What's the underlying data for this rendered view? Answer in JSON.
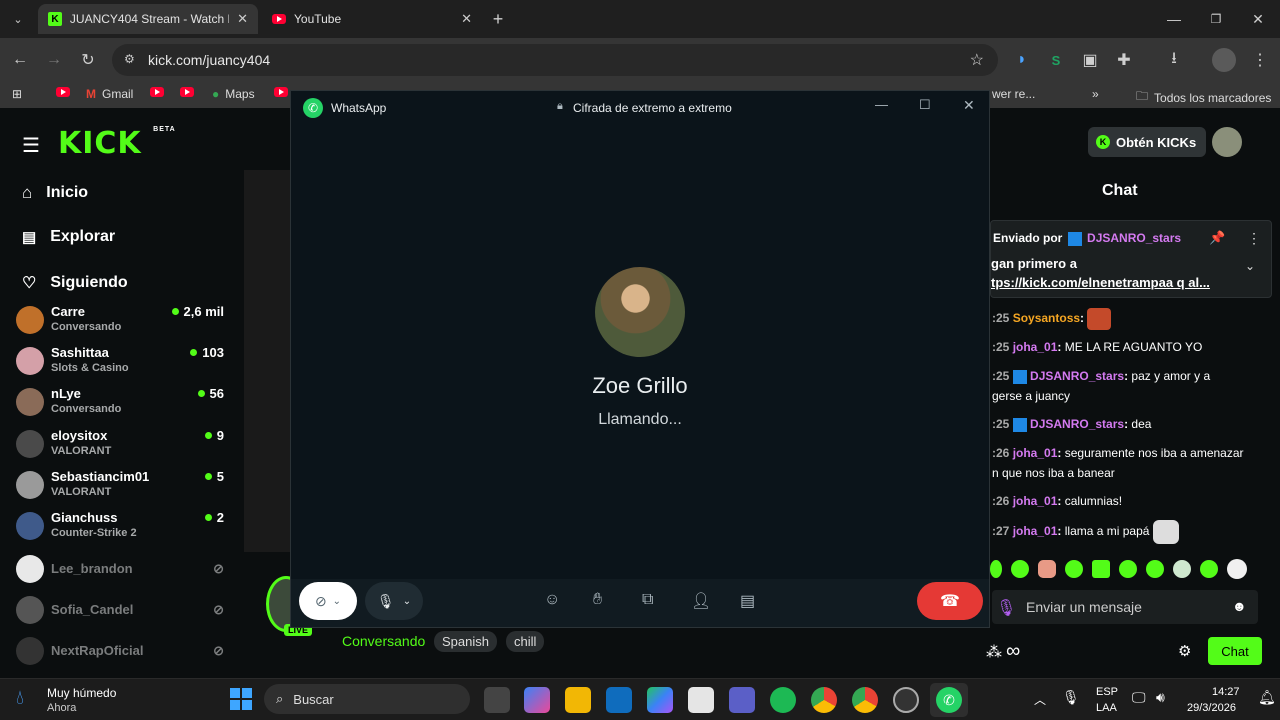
{
  "browser": {
    "tabs": [
      {
        "title": "JUANCY404 Stream - Watch Liv"
      },
      {
        "title": "YouTube"
      }
    ],
    "url": "kick.com/juancy404",
    "bookmarks": [
      "Gmail",
      "Maps",
      "wer re...",
      "Todos los marcadores"
    ]
  },
  "kick": {
    "logo": "KICK",
    "logo_badge": "BETA",
    "nav": [
      "Inicio",
      "Explorar",
      "Siguiendo"
    ],
    "channels": [
      {
        "name": "Carre",
        "sub": "Conversando",
        "viewers": "2,6 mil",
        "live": true
      },
      {
        "name": "Sashittaa",
        "sub": "Slots & Casino",
        "viewers": "103",
        "live": true
      },
      {
        "name": "nLye",
        "sub": "Conversando",
        "viewers": "56",
        "live": true
      },
      {
        "name": "eloysitox",
        "sub": "VALORANT",
        "viewers": "9",
        "live": true
      },
      {
        "name": "Sebastiancim01",
        "sub": "VALORANT",
        "viewers": "5",
        "live": true
      },
      {
        "name": "Gianchuss",
        "sub": "Counter-Strike 2",
        "viewers": "2",
        "live": true
      },
      {
        "name": "Lee_brandon",
        "sub": "",
        "viewers": "",
        "live": false
      },
      {
        "name": "Sofia_Candel",
        "sub": "",
        "viewers": "",
        "live": false
      },
      {
        "name": "NextRapOficial",
        "sub": "",
        "viewers": "",
        "live": false
      }
    ],
    "live_badge": "LIVE",
    "tags": [
      "Conversando",
      "Spanish",
      "chill"
    ],
    "obtain_kicks": "Obtén KICKs",
    "chat": {
      "header": "Chat",
      "pinned_by_label": "Enviado por",
      "pinned_user": "DJSANRO_stars",
      "pinned_line1": "gan primero a",
      "pinned_line2": "tps://kick.com/elnenetrampaa q al...",
      "messages": [
        {
          "time": ":25",
          "user": "Soysantoss",
          "text": ""
        },
        {
          "time": ":25",
          "user": "joha_01",
          "text": "ME LA RE AGUANTO YO"
        },
        {
          "time": ":25",
          "user": "DJSANRO_stars",
          "text": "paz y amor y a"
        },
        {
          "time": "",
          "user": "",
          "text": "gerse a juancy"
        },
        {
          "time": ":25",
          "user": "DJSANRO_stars",
          "text": "dea"
        },
        {
          "time": ":26",
          "user": "joha_01",
          "text": "seguramente nos iba a amenazar"
        },
        {
          "time": "",
          "user": "",
          "text": "n que nos iba a banear"
        },
        {
          "time": ":26",
          "user": "joha_01",
          "text": "calumnias!"
        },
        {
          "time": ":27",
          "user": "joha_01",
          "text": "llama a mi papá"
        }
      ],
      "input_placeholder": "Enviar un mensaje",
      "send_label": "Chat",
      "infinity": "∞"
    }
  },
  "whatsapp": {
    "app_name": "WhatsApp",
    "encryption": "Cifrada de extremo a extremo",
    "contact_name": "Zoe Grillo",
    "call_status": "Llamando..."
  },
  "taskbar": {
    "weather_title": "Muy húmedo",
    "weather_sub": "Ahora",
    "search_placeholder": "Buscar",
    "lang_top": "ESP",
    "lang_bottom": "LAA",
    "time": "14:27",
    "date": "29/3/2026"
  },
  "colors": {
    "kick_green": "#53fc18",
    "whatsapp_green": "#25d366",
    "hangup_red": "#e53935"
  }
}
